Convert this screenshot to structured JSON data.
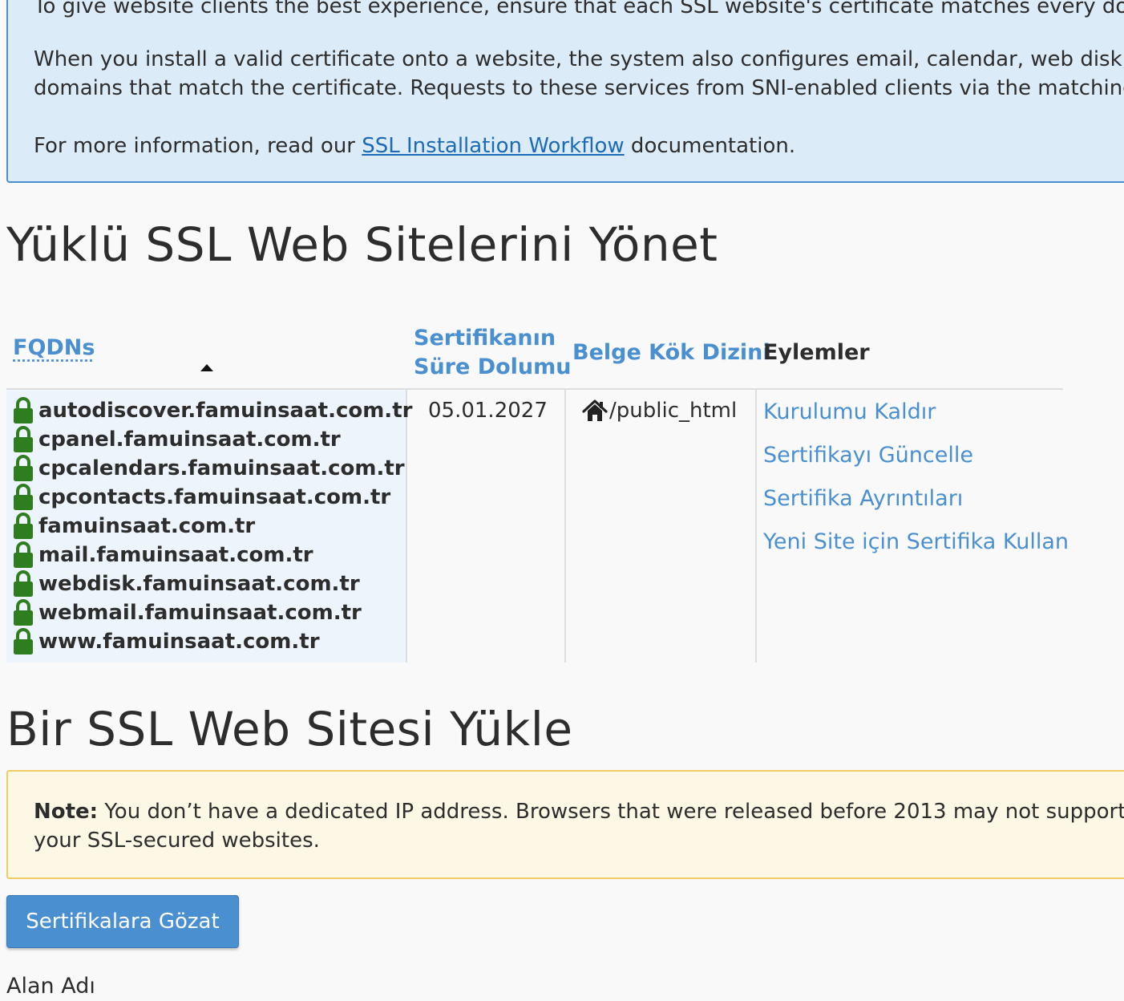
{
  "info": {
    "line1": "To give website clients the best experience, ensure that each SSL website's certificate matches every don",
    "line2": "When you install a valid certificate onto a website, the system also configures email, calendar, web disk, a",
    "line3": "domains that match the certificate. Requests to these services from SNI-enabled clients via the matching",
    "more_prefix": "For more information, read our ",
    "more_link": "SSL Installation Workflow",
    "more_suffix": " documentation."
  },
  "manage": {
    "title": "Yüklü SSL Web Sitelerini Yönet",
    "columns": {
      "fqdns": "FQDNs",
      "expire_line1": "Sertifikanın",
      "expire_line2": "Süre Dolumu",
      "docroot": "Belge Kök Dizini",
      "actions": "Eylemler"
    },
    "row": {
      "fqdns": [
        "autodiscover.famuinsaat.com.tr",
        "cpanel.famuinsaat.com.tr",
        "cpcalendars.famuinsaat.com.tr",
        "cpcontacts.famuinsaat.com.tr",
        "famuinsaat.com.tr",
        "mail.famuinsaat.com.tr",
        "webdisk.famuinsaat.com.tr",
        "webmail.famuinsaat.com.tr",
        "www.famuinsaat.com.tr"
      ],
      "expiry": "05.01.2027",
      "docroot": "/public_html",
      "actions": [
        "Kurulumu Kaldır",
        "Sertifikayı Güncelle",
        "Sertifika Ayrıntıları",
        "Yeni Site için Sertifika Kullan"
      ]
    }
  },
  "install": {
    "title": "Bir SSL Web Sitesi Yükle",
    "note_label": "Note:",
    "note_line1": " You don’t have a dedicated IP address. Browsers that were released before 2013 may not support",
    "note_line2": "your SSL-secured websites.",
    "browse_button": "Sertifikalara Gözat",
    "domain_label": "Alan Adı"
  },
  "colors": {
    "link": "#4a8fd0",
    "lock": "#2e7d1e",
    "info_bg": "#dcebf8",
    "note_bg": "#fcf8e5"
  }
}
